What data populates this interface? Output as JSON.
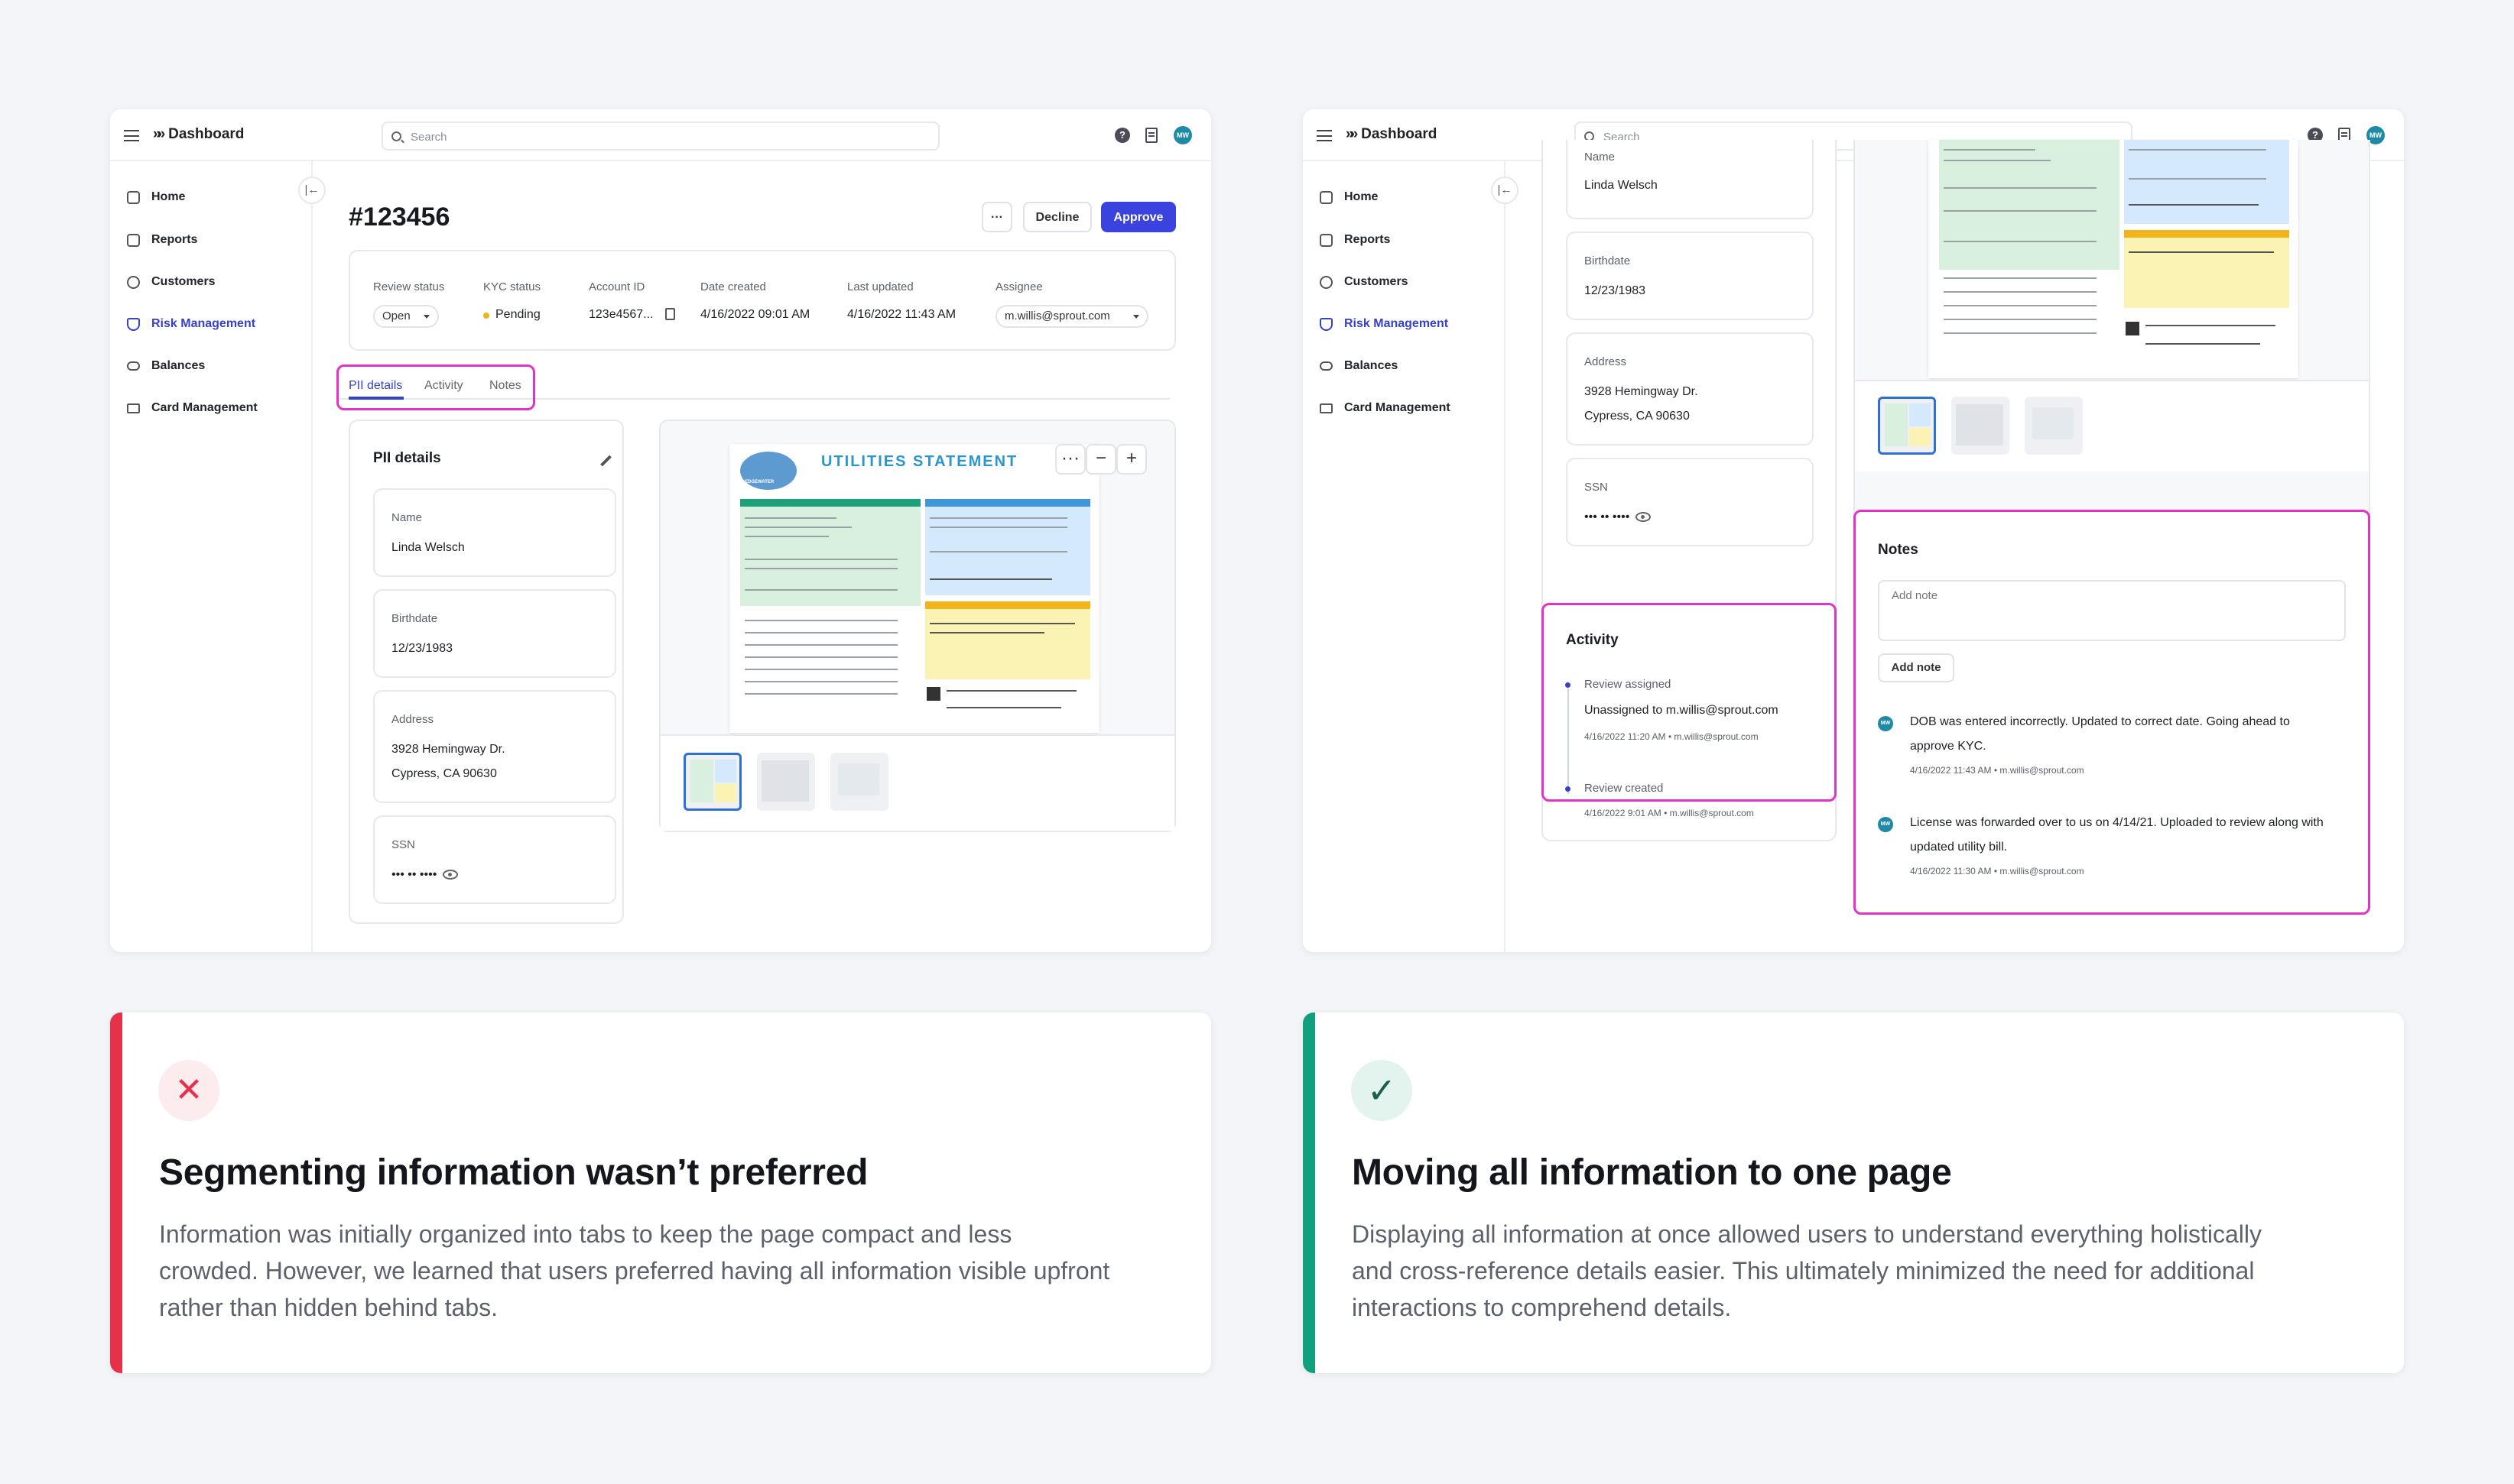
{
  "colors": {
    "accent": "#3a43dd",
    "highlight": "#e232c8",
    "bad": "#e5324a",
    "good": "#11a07e"
  },
  "app": {
    "title": "Dashboard",
    "search_placeholder": "Search",
    "help_icon": "?",
    "avatar": "MW",
    "nav": [
      {
        "label": "Home",
        "icon": "home-icon"
      },
      {
        "label": "Reports",
        "icon": "report-icon"
      },
      {
        "label": "Customers",
        "icon": "customers-icon"
      },
      {
        "label": "Risk Management",
        "icon": "shield-icon",
        "active": true
      },
      {
        "label": "Balances",
        "icon": "balances-icon"
      },
      {
        "label": "Card Management",
        "icon": "card-icon"
      }
    ]
  },
  "case": {
    "id": "#123456",
    "more_label": "···",
    "decline_label": "Decline",
    "approve_label": "Approve",
    "summary": {
      "review_status": {
        "label": "Review status",
        "value": "Open"
      },
      "kyc_status": {
        "label": "KYC status",
        "value": "Pending"
      },
      "account_id": {
        "label": "Account ID",
        "value": "123e4567..."
      },
      "date_created": {
        "label": "Date created",
        "value": "4/16/2022 09:01 AM"
      },
      "last_updated": {
        "label": "Last updated",
        "value": "4/16/2022 11:43 AM"
      },
      "assignee": {
        "label": "Assignee",
        "value": "m.willis@sprout.com"
      }
    },
    "tabs": [
      "PII details",
      "Activity",
      "Notes"
    ]
  },
  "pii": {
    "title": "PII details",
    "name": {
      "label": "Name",
      "value": "Linda Welsch"
    },
    "birthdate": {
      "label": "Birthdate",
      "value": "12/23/1983"
    },
    "address": {
      "label": "Address",
      "line1": "3928 Hemingway Dr.",
      "line2": "Cypress, CA 90630"
    },
    "ssn": {
      "label": "SSN",
      "value": "••• •• ••••"
    }
  },
  "document": {
    "title": "UTILITIES STATEMENT",
    "logo_text": "EDGEWATER",
    "more_label": "···",
    "zoom_out": "−",
    "zoom_in": "+"
  },
  "activity": {
    "title": "Activity",
    "items": [
      {
        "title": "Review assigned",
        "detail": "Unassigned to m.willis@sprout.com",
        "meta": "4/16/2022 11:20 AM • m.willis@sprout.com"
      },
      {
        "title": "Review created",
        "meta": "4/16/2022 9:01 AM • m.willis@sprout.com"
      }
    ]
  },
  "notes": {
    "title": "Notes",
    "placeholder": "Add note",
    "add_label": "Add note",
    "items": [
      {
        "avatar": "MW",
        "line1": "DOB was entered incorrectly. Updated to correct date. Going ahead to",
        "line2": "approve KYC.",
        "meta": "4/16/2022 11:43 AM • m.willis@sprout.com"
      },
      {
        "avatar": "MW",
        "line1": "License was forwarded over to us on 4/14/21. Uploaded to review along with",
        "line2": "updated utility bill.",
        "meta": "4/16/2022 11:30 AM • m.willis@sprout.com"
      }
    ]
  },
  "captions": {
    "left": {
      "icon": "✕",
      "title": "Segmenting information wasn’t preferred",
      "line1": "Information was initially organized into tabs to keep the page compact and less",
      "line2": "crowded. However, we learned that users preferred having all information visible upfront",
      "line3": "rather than hidden behind tabs."
    },
    "right": {
      "icon": "✓",
      "title": "Moving all information to one page",
      "line1": "Displaying all information at once allowed users to understand everything holistically",
      "line2": "and cross-reference details easier. This ultimately minimized the need for additional",
      "line3": "interactions to comprehend details."
    }
  }
}
